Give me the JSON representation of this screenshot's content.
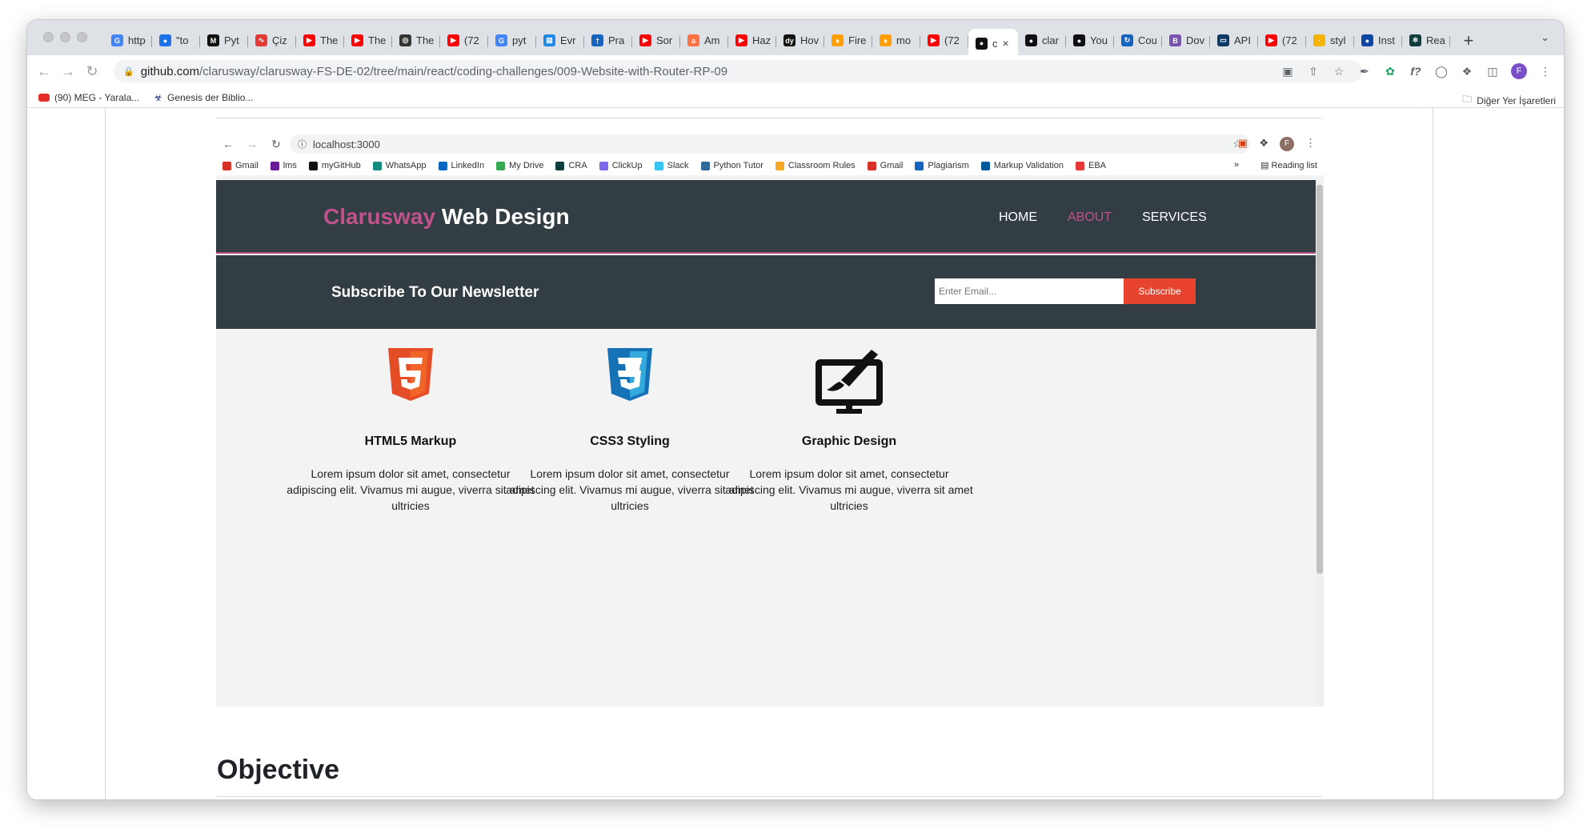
{
  "browser": {
    "tabs": [
      {
        "title": "http",
        "icon": "google-icon",
        "color": "#4285f4",
        "glyph": "G"
      },
      {
        "title": "\"to",
        "icon": "chat-icon",
        "color": "#1a73e8",
        "glyph": "●"
      },
      {
        "title": "Pyt",
        "icon": "medium-icon",
        "color": "#111111",
        "glyph": "M"
      },
      {
        "title": "Çiz",
        "icon": "scribble-icon",
        "color": "#e53935",
        "glyph": "∿"
      },
      {
        "title": "The",
        "icon": "youtube-icon",
        "color": "#ff0000",
        "glyph": "▶"
      },
      {
        "title": "The",
        "icon": "youtube-icon",
        "color": "#ff0000",
        "glyph": "▶"
      },
      {
        "title": "The",
        "icon": "robot-icon",
        "color": "#333333",
        "glyph": "◎"
      },
      {
        "title": "(72",
        "icon": "youtube-icon",
        "color": "#ff0000",
        "glyph": "▶"
      },
      {
        "title": "pyt",
        "icon": "google-icon",
        "color": "#4285f4",
        "glyph": "G"
      },
      {
        "title": "Evr",
        "icon": "calendar-icon",
        "color": "#1e88e5",
        "glyph": "▤"
      },
      {
        "title": "Pra",
        "icon": "pin-icon",
        "color": "#1565c0",
        "glyph": "†"
      },
      {
        "title": "Sor",
        "icon": "youtube-icon",
        "color": "#ff0000",
        "glyph": "▶"
      },
      {
        "title": "Am",
        "icon": "amazon-icon",
        "color": "#ff7043",
        "glyph": "a"
      },
      {
        "title": "Haz",
        "icon": "youtube-icon",
        "color": "#ff0000",
        "glyph": "▶"
      },
      {
        "title": "Hov",
        "icon": "dev-icon",
        "color": "#111111",
        "glyph": "dy"
      },
      {
        "title": "Fire",
        "icon": "firebase-icon",
        "color": "#ffa000",
        "glyph": "♦"
      },
      {
        "title": "mo",
        "icon": "firebase-icon",
        "color": "#ffa000",
        "glyph": "♦"
      },
      {
        "title": "(72",
        "icon": "youtube-icon",
        "color": "#ff0000",
        "glyph": "▶"
      },
      {
        "title": "c",
        "icon": "github-icon",
        "color": "#111111",
        "glyph": "●",
        "active": true
      },
      {
        "title": "clar",
        "icon": "github-icon",
        "color": "#111111",
        "glyph": "●"
      },
      {
        "title": "You",
        "icon": "github-icon",
        "color": "#111111",
        "glyph": "●"
      },
      {
        "title": "Cou",
        "icon": "refresh-icon",
        "color": "#1565c0",
        "glyph": "↻"
      },
      {
        "title": "Dov",
        "icon": "bootstrap-icon",
        "color": "#7952b3",
        "glyph": "B"
      },
      {
        "title": "API",
        "icon": "api-icon",
        "color": "#0d3b66",
        "glyph": "▭"
      },
      {
        "title": "(72",
        "icon": "youtube-icon",
        "color": "#ff0000",
        "glyph": "▶"
      },
      {
        "title": "styl",
        "icon": "style-icon",
        "color": "#f4b400",
        "glyph": "·"
      },
      {
        "title": "Inst",
        "icon": "globe-icon",
        "color": "#0d47a1",
        "glyph": "●"
      },
      {
        "title": "Rea",
        "icon": "react-icon",
        "color": "#0f3d3e",
        "glyph": "⚛"
      }
    ],
    "url_host": "github.com",
    "url_path": "/clarusway/clarusway-FS-DE-02/tree/main/react/coding-challenges/009-Website-with-Router-RP-09",
    "avatar": "F",
    "bookmarks": [
      {
        "label": "(90) MEG - Yarala...",
        "icon": "youtube-icon"
      },
      {
        "label": "Genesis der Biblio...",
        "icon": "bookmark-icon"
      }
    ],
    "other_bookmarks": "Diğer Yer İşaretleri"
  },
  "inner_browser": {
    "url": "localhost:3000",
    "avatar": "F",
    "bookmarks": [
      {
        "label": "Gmail",
        "color": "#d93025"
      },
      {
        "label": "lms",
        "color": "#6a1b9a"
      },
      {
        "label": "myGitHub",
        "color": "#111111"
      },
      {
        "label": "WhatsApp",
        "color": "#128c7e"
      },
      {
        "label": "LinkedIn",
        "color": "#0a66c2"
      },
      {
        "label": "My Drive",
        "color": "#34a853"
      },
      {
        "label": "CRA",
        "color": "#0f3d3e"
      },
      {
        "label": "ClickUp",
        "color": "#7b68ee"
      },
      {
        "label": "Slack",
        "color": "#36c5f0"
      },
      {
        "label": "Python Tutor",
        "color": "#306998"
      },
      {
        "label": "Classroom Rules",
        "color": "#f9a825"
      },
      {
        "label": "Gmail",
        "color": "#d93025"
      },
      {
        "label": "Plagiarism",
        "color": "#1565c0"
      },
      {
        "label": "Markup Validation",
        "color": "#005a9c"
      },
      {
        "label": "EBA",
        "color": "#e53935"
      }
    ],
    "more": "»",
    "reading_list": "Reading list"
  },
  "site": {
    "brand_accent": "Clarusway",
    "brand_rest": " Web Design",
    "nav": [
      "HOME",
      "ABOUT",
      "SERVICES"
    ],
    "nav_active": "ABOUT",
    "newsletter_title": "Subscribe To Our Newsletter",
    "email_placeholder": "Enter Email...",
    "subscribe_label": "Subscribe",
    "cards": [
      {
        "title": "HTML5 Markup",
        "text": "Lorem ipsum dolor sit amet, consectetur adipiscing elit. Vivamus mi augue, viverra sit amet ultricies",
        "icon": "html5-icon"
      },
      {
        "title": "CSS3 Styling",
        "text": "Lorem ipsum dolor sit amet, consectetur adipiscing elit. Vivamus mi augue, viverra sit amet ultricies",
        "icon": "css3-icon"
      },
      {
        "title": "Graphic Design",
        "text": "Lorem ipsum dolor sit amet, consectetur adipiscing elit. Vivamus mi augue, viverra sit amet ultricies",
        "icon": "monitor-brush-icon"
      }
    ],
    "colors": {
      "header": "#333d44",
      "accent": "#c0528b",
      "subscribe": "#e8432d",
      "body": "#f3f3f3"
    }
  },
  "github": {
    "objective_heading": "Objective"
  }
}
